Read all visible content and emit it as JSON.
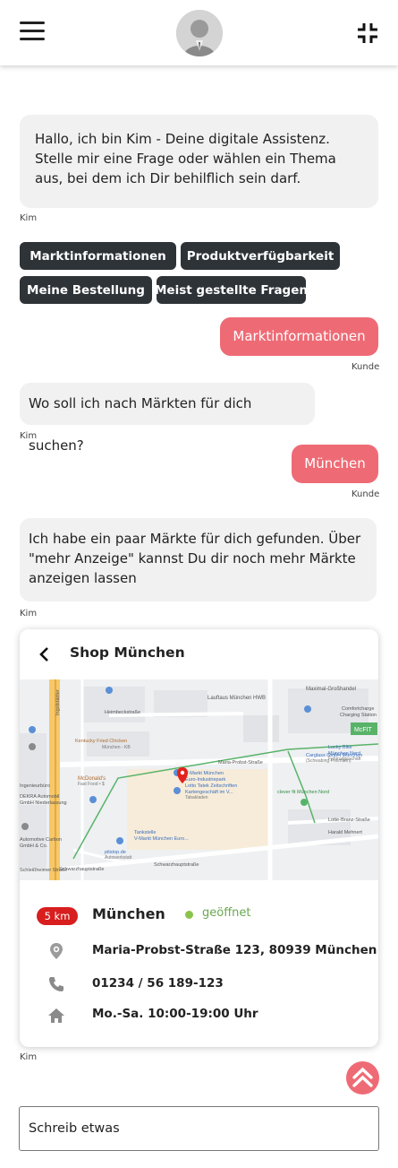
{
  "header": {
    "menu_icon": "hamburger-menu-icon",
    "avatar_icon": "user-avatar-icon",
    "collapse_icon": "collapse-arrows-icon"
  },
  "chat": {
    "welcome": "Hallo, ich bin Kim - Deine digitale Assistenz. Stelle mir eine Frage oder wählen ein Thema aus, bei dem ich Dir behilflich sein darf.",
    "bot_name": "Kim",
    "user_name": "Kunde",
    "chips": [
      "Marktinformationen",
      "Produktverfügbarkeit",
      "Meine Bestellung",
      "Meist gestellte Fragen"
    ],
    "user_msg_1": "Marktinformationen",
    "bot_msg_2": "Wo soll ich nach Märkten für dich suchen?",
    "user_msg_2": "München",
    "bot_msg_3": "Ich habe ein paar Märkte für dich gefunden. Über \"mehr Anzeige\" kannst Du dir noch mehr Märkte anzeigen lassen"
  },
  "shop_card": {
    "title": "Shop München",
    "distance": "5 km",
    "city": "München",
    "status": "geöffnet",
    "address": "Maria-Probst-Straße 123, 80939 München",
    "phone": "01234 / 56 189-123",
    "hours": "Mo.-Sa. 10:00-19:00 Uhr",
    "map_labels": {
      "lauftaus": "Lauftaus München HWB",
      "maximal": "Maximal-Großhandel",
      "comfort": "Comfortcharge",
      "comfort2": "Charging Station",
      "kfc": "Kentucky Fried Chicken",
      "kfc_sub": "München - KB",
      "lucky": "Lucky Bike",
      "lucky2": "München Nord",
      "lucky3": "Fahrradgeschäft",
      "mcfit": "McFIT",
      "probst": "Maria-Probst-Straße",
      "carglass": "Carglass GmbH München",
      "carglass2": "(Schwabing-Freimann)",
      "mcdonalds": "McDonald's",
      "mcdonalds2": "Fast Food • $",
      "vmarkt": "V-Markt München",
      "vmarkt2": "Euro-Industriepark",
      "lotto": "Lotto Tatek Zeitschriften",
      "lotto2": "Kartengeschäft im V...",
      "lotto3": "Tabakladen",
      "clever": "clever fit München Nord",
      "ingenieur": "Ingenieurbüro",
      "dekra": "DEKRA Automobil",
      "dekra2": "GmbH Niederlassung",
      "automotive": "Automotive Carbon",
      "automotive2": "GmbH & Co.",
      "tankstelle": "Tankstelle",
      "tankstelle2": "V-Markt München Euro...",
      "pitstop": "pitstop.de",
      "pitstop2": "Autowerkstatt",
      "lotte": "Lotte-Branz-Straße",
      "harald": "Harald Mehnert",
      "schwarzhaupt": "Schwarzhauptstraße",
      "schwarzhaupt2": "Schwarzhauptstraße",
      "schleissheimer": "Schleißheimer Straße",
      "heimbeck": "Heimbeckstraße",
      "ingolstaedter": "Ingolstädter"
    }
  },
  "footer": {
    "scroll_top_icon": "chevron-up-icon",
    "input_placeholder": "Schreib etwas"
  }
}
